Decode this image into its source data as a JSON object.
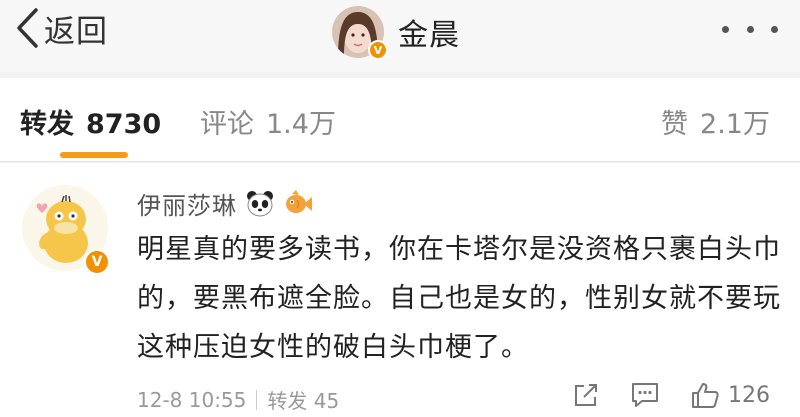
{
  "nav": {
    "back_label": "返回",
    "user_name": "金晨"
  },
  "tabs": {
    "repost": {
      "label": "转发",
      "count": "8730"
    },
    "comment": {
      "label": "评论",
      "count": "1.4万"
    },
    "like": {
      "label": "赞",
      "count": "2.1万"
    }
  },
  "post": {
    "author": "伊丽莎琳",
    "badges": [
      "panda-icon",
      "fish-icon"
    ],
    "content": "明星真的要多读书，你在卡塔尔是没资格只裹白头巾的，要黑布遮全脸。自己也是女的，性别女就不要玩这种压迫女性的破白头巾梗了。",
    "time": "12-8 10:55",
    "repost_label": "转发 45",
    "like_count": "126"
  },
  "colors": {
    "accent": "#f49b19",
    "verified_badge": "#f29100",
    "secondary_text": "#888888"
  }
}
